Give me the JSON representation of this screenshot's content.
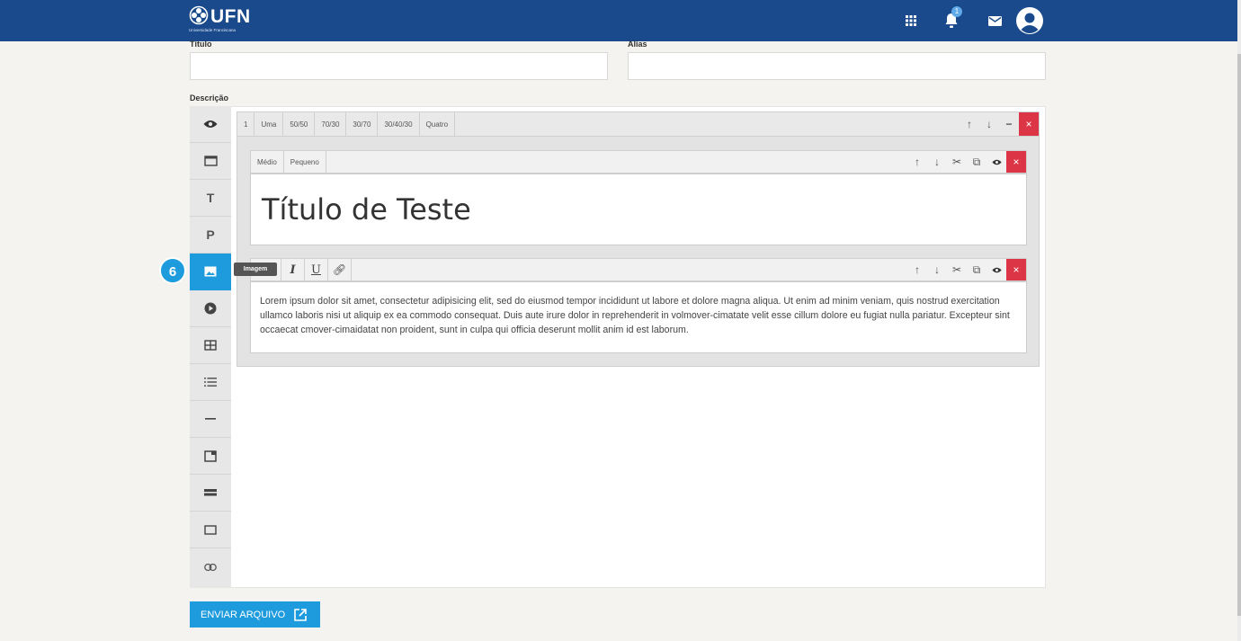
{
  "header": {
    "logo_text": "UFN",
    "logo_subtext": "Universidade Franciscana",
    "notification_count": "1",
    "icons": [
      "apps-grid-icon",
      "bell-icon",
      "mail-icon",
      "user-avatar-icon"
    ]
  },
  "form": {
    "title_label": "Título",
    "title_value": "",
    "alias_label": "Alias",
    "alias_value": "",
    "description_label": "Descrição"
  },
  "tools": [
    {
      "name": "preview-tool",
      "icon": "eye-icon"
    },
    {
      "name": "container-tool",
      "icon": "window-icon"
    },
    {
      "name": "title-tool",
      "icon": "T"
    },
    {
      "name": "paragraph-tool",
      "icon": "P"
    },
    {
      "name": "image-tool",
      "icon": "image-icon",
      "active": true
    },
    {
      "name": "video-tool",
      "icon": "play-icon"
    },
    {
      "name": "table-tool",
      "icon": "table-icon"
    },
    {
      "name": "list-tool",
      "icon": "list-icon"
    },
    {
      "name": "divider-tool",
      "icon": "dash-icon"
    },
    {
      "name": "box-tool",
      "icon": "box-icon"
    },
    {
      "name": "bar-tool",
      "icon": "bar-icon"
    },
    {
      "name": "frame-tool",
      "icon": "frame-icon"
    },
    {
      "name": "link-tool",
      "icon": "link-icon"
    }
  ],
  "step_marker": "6",
  "tooltip": "Imagem",
  "row_layouts": [
    "1",
    "Uma",
    "50/50",
    "70/30",
    "30/70",
    "30/40/30",
    "Quatro"
  ],
  "block1": {
    "sizes": [
      "Médio",
      "Pequeno"
    ],
    "heading": "Título de Teste"
  },
  "block2": {
    "text": "Lorem ipsum dolor sit amet, consectetur adipisicing elit, sed do eiusmod tempor incididunt ut labore et dolore magna aliqua. Ut enim ad minim veniam, quis nostrud exercitation ullamco laboris nisi ut aliquip ex ea commodo consequat. Duis aute irure dolor in reprehenderit in volmover-cimatate velit esse cillum dolore eu fugiat nulla pariatur. Excepteur sint occaecat cmover-cimaidatat non proident, sunt in culpa qui officia deserunt mollit anim id est laborum."
  },
  "send_button": "ENVIAR ARQUIVO",
  "colors": {
    "header": "#1a4a8c",
    "accent": "#1e9bdd",
    "danger": "#dc3545"
  }
}
